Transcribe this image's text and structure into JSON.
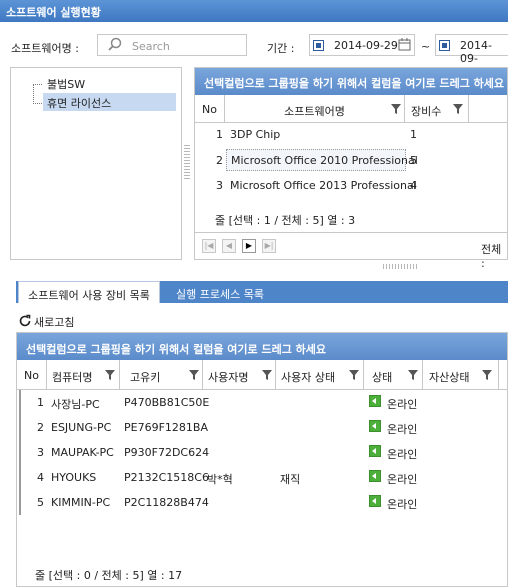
{
  "window": {
    "title": "소프트웨어 실행현황"
  },
  "filter": {
    "software_label": "소프트웨어명 :",
    "search_placeholder": "Search",
    "period_label": "기간 :",
    "date_from": "2014-09-29",
    "date_separator": "~",
    "date_to": "2014-09-"
  },
  "tree": {
    "items": [
      {
        "label": "불법SW"
      },
      {
        "label": "휴면 라이선스"
      }
    ]
  },
  "software_grid": {
    "group_hint": "선택컬럼으로 그룹핑을 하기 위해서 컬럼을 여기로 드레그 하세요",
    "columns": [
      "No",
      "소프트웨어명",
      "장비수"
    ],
    "rows": [
      {
        "no": "1",
        "name": "3DP Chip",
        "count": "1"
      },
      {
        "no": "2",
        "name": "Microsoft Office 2010 Professional",
        "count": "5"
      },
      {
        "no": "3",
        "name": "Microsoft Office 2013 Professional",
        "count": "4"
      }
    ],
    "footer": "줄 [선택 : 1 / 전체 : 5] 열 : 3",
    "pager_total": "전체 :"
  },
  "tabs": [
    {
      "label": "소프트웨어 사용 장비 목록"
    },
    {
      "label": "실행 프로세스 목록"
    }
  ],
  "refresh_label": "새로고침",
  "device_grid": {
    "group_hint": "선택컬럼으로 그룹핑을 하기 위해서 컬럼을 여기로 드레그 하세요",
    "columns": [
      "No",
      "컴퓨터명",
      "고유키",
      "사용자명",
      "사용자 상태",
      "상태",
      "자산상태"
    ],
    "rows": [
      {
        "no": "1",
        "pc": "사장님-PC",
        "key": "P470BB81C50E",
        "user": "",
        "user_state": "",
        "state": "온라인"
      },
      {
        "no": "2",
        "pc": "ESJUNG-PC",
        "key": "PE769F1281BA",
        "user": "",
        "user_state": "",
        "state": "온라인"
      },
      {
        "no": "3",
        "pc": "MAUPAK-PC",
        "key": "P930F72DC624",
        "user": "",
        "user_state": "",
        "state": "온라인"
      },
      {
        "no": "4",
        "pc": "HYOUKS",
        "key": "P2132C1518C6",
        "user": "박*혁",
        "user_state": "재직",
        "state": "온라인"
      },
      {
        "no": "5",
        "pc": "KIMMIN-PC",
        "key": "P2C11828B474",
        "user": "",
        "user_state": "",
        "state": "온라인"
      }
    ],
    "footer": "줄 [선택 : 0 / 전체 : 5] 열 : 17"
  },
  "colors": {
    "title_bar": "#3f78c2",
    "group_bar": "#5b8bca",
    "selected_row": "#c6d9f1",
    "online": "#4caf3a"
  }
}
